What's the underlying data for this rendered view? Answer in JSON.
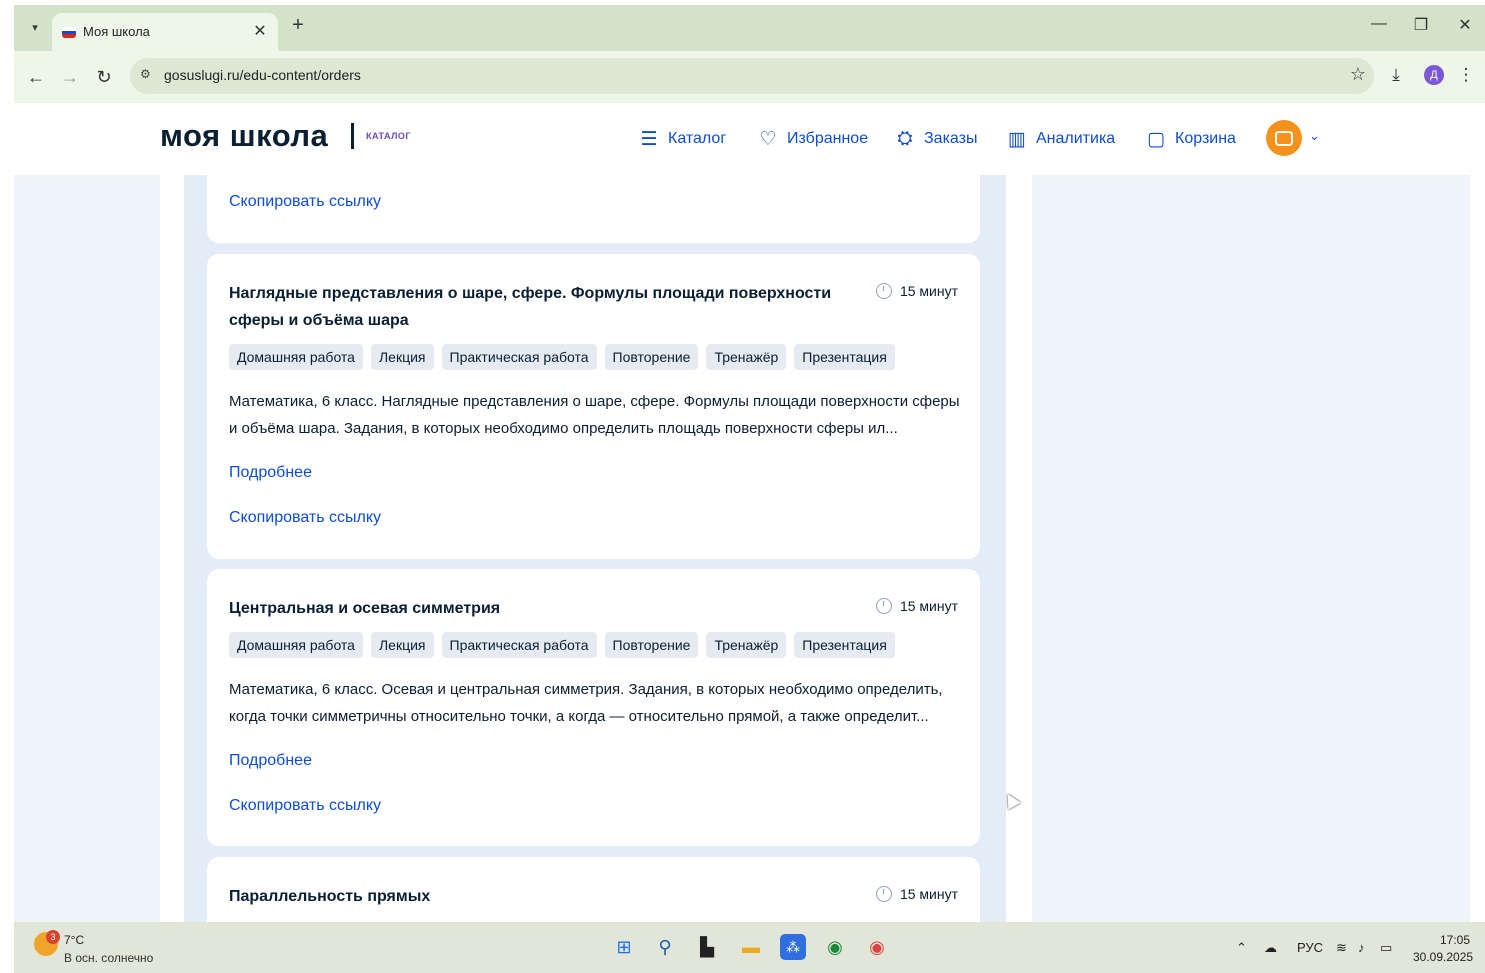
{
  "browser": {
    "tab_title": "Моя школа",
    "url": "gosuslugi.ru/edu-content/orders",
    "profile_initial": "Д"
  },
  "site": {
    "logo": "моя школа",
    "logo_sub": "КАТАЛОГ",
    "menu": [
      {
        "label": "Каталог",
        "icon": "list-icon"
      },
      {
        "label": "Избранное",
        "icon": "heart-icon"
      },
      {
        "label": "Заказы",
        "icon": "orders-icon"
      },
      {
        "label": "Аналитика",
        "icon": "chart-icon"
      },
      {
        "label": "Корзина",
        "icon": "bag-icon"
      }
    ]
  },
  "cards": [
    {
      "copy_link": "Скопировать ссылку"
    },
    {
      "title": "Наглядные представления о шаре, сфере. Формулы площади поверхности сферы и объёма шара",
      "duration": "15 минут",
      "tags": [
        "Домашняя работа",
        "Лекция",
        "Практическая работа",
        "Повторение",
        "Тренажёр",
        "Презентация"
      ],
      "description": "Математика, 6 класс. Наглядные представления о шаре, сфере. Формулы площади поверхности сферы и объёма шара. Задания, в которых необходимо определить площадь поверхности сферы ил...",
      "more": "Подробнее",
      "copy_link": "Скопировать ссылку"
    },
    {
      "title": "Центральная и осевая симметрия",
      "duration": "15 минут",
      "tags": [
        "Домашняя работа",
        "Лекция",
        "Практическая работа",
        "Повторение",
        "Тренажёр",
        "Презентация"
      ],
      "description": "Математика, 6 класс. Осевая и центральная симметрия. Задания, в которых необходимо определить, когда точки симметричны относительно точки, а когда — относительно прямой, а также определит...",
      "more": "Подробнее",
      "copy_link": "Скопировать ссылку"
    },
    {
      "title": "Параллельность прямых",
      "duration": "15 минут"
    }
  ],
  "taskbar": {
    "weather_badge": "3",
    "temperature": "7°C",
    "weather_desc": "В осн. солнечно",
    "language": "РУС",
    "time": "17:05",
    "date": "30.09.2025"
  }
}
